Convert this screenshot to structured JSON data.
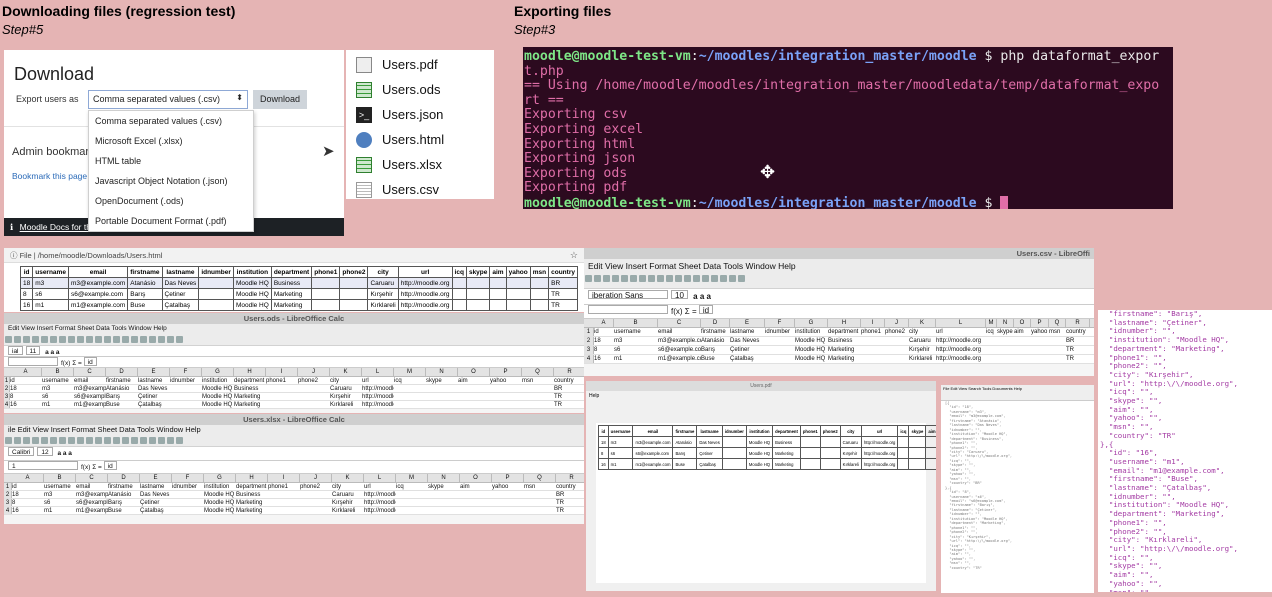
{
  "sections": {
    "download": {
      "title": "Downloading files (regression test)",
      "step": "Step#5"
    },
    "export": {
      "title": "Exporting files",
      "step": "Step#3"
    }
  },
  "moodle": {
    "title": "Download",
    "export_label": "Export users as",
    "select_value": "Comma separated values (.csv)",
    "download_button": "Download",
    "options": [
      "Comma separated values (.csv)",
      "Microsoft Excel (.xlsx)",
      "HTML table",
      "Javascript Object Notation (.json)",
      "OpenDocument (.ods)",
      "Portable Document Format (.pdf)"
    ],
    "admin_label": "Admin bookmarks",
    "bookmark_link": "Bookmark this page",
    "footer_link": "Moodle Docs for this page"
  },
  "files": [
    {
      "name": "Users.pdf",
      "icon": "pdf-file-icon",
      "color": "#666666"
    },
    {
      "name": "Users.ods",
      "icon": "spreadsheet-file-icon",
      "color": "#3a9c3a"
    },
    {
      "name": "Users.json",
      "icon": "terminal-file-icon",
      "color": "#222222"
    },
    {
      "name": "Users.html",
      "icon": "globe-file-icon",
      "color": "#4f7fbf"
    },
    {
      "name": "Users.xlsx",
      "icon": "spreadsheet-file-icon",
      "color": "#3a9c3a"
    },
    {
      "name": "Users.csv",
      "icon": "text-file-icon",
      "color": "#888888"
    }
  ],
  "terminal": {
    "prompt_user": "moodle@moodle-test-vm",
    "prompt_path": "~/moodles/integration_master/moodle",
    "command": "$ php dataformat_expor",
    "command_wrap": "t.php",
    "lines": [
      "== Using /home/moodle/moodles/integration_master/moodledata/temp/dataformat_expo",
      "rt ==",
      "Exporting csv",
      "Exporting excel",
      "Exporting html",
      "Exporting json",
      "Exporting ods",
      "Exporting pdf"
    ],
    "prompt_end": "$"
  },
  "browser": {
    "url": "File  |  /home/moodle/Downloads/Users.html"
  },
  "table": {
    "headers": [
      "id",
      "username",
      "email",
      "firstname",
      "lastname",
      "idnumber",
      "institution",
      "department",
      "phone1",
      "phone2",
      "city",
      "url",
      "icq",
      "skype",
      "aim",
      "yahoo",
      "msn",
      "country"
    ],
    "rows": [
      [
        "18",
        "m3",
        "m3@example.com",
        "Atanásio",
        "Das Neves",
        "",
        "Moodle HQ",
        "Business",
        "",
        "",
        "Caruaru",
        "http://moodle.org",
        "",
        "",
        "",
        "",
        "",
        "BR"
      ],
      [
        "8",
        "s6",
        "s6@example.com",
        "Barış",
        "Çetiner",
        "",
        "Moodle HQ",
        "Marketing",
        "",
        "",
        "Kırşehir",
        "http://moodle.org",
        "",
        "",
        "",
        "",
        "",
        "TR"
      ],
      [
        "16",
        "m1",
        "m1@example.com",
        "Buse",
        "Çatalbaş",
        "",
        "Moodle HQ",
        "Marketing",
        "",
        "",
        "Kırklareli",
        "http://moodle.org",
        "",
        "",
        "",
        "",
        "",
        "TR"
      ]
    ]
  },
  "ods": {
    "title": "Users.ods - LibreOffice Calc",
    "menu": "Edit  View  Insert  Format  Sheet  Data  Tools  Window  Help",
    "font": "ial",
    "size": "11",
    "cell": "id"
  },
  "xlsx": {
    "title": "Users.xlsx - LibreOffice Calc",
    "menu": "ile  Edit  View  Insert  Format  Sheet  Data  Tools  Window  Help",
    "font": "Calibri",
    "size": "12",
    "cell": "id",
    "name_box": "1"
  },
  "csv": {
    "title": "Users.csv - LibreOffi",
    "menu": "Edit  View  Insert  Format  Sheet  Data  Tools  Window  Help",
    "font": "iberation Sans",
    "size": "10",
    "cell": "id"
  },
  "pdf": {
    "title": "Users.pdf",
    "menu": "Help"
  },
  "json_small": {
    "menu": "File  Edit  View  Search  Tools  Documents  Help",
    "text": "[{\n  \"id\": \"18\",\n  \"username\": \"m3\",\n  \"email\": \"m3@example.com\",\n  \"firstname\": \"Atanásio\",\n  \"lastname\": \"Das Neves\",\n  \"idnumber\": \"\",\n  \"institution\": \"Moodle HQ\",\n  \"department\": \"Business\",\n  \"phone1\": \"\",\n  \"phone2\": \"\",\n  \"city\": \"Caruaru\",\n  \"url\": \"http:\\/\\/moodle.org\",\n  \"icq\": \"\",\n  \"skype\": \"\",\n  \"aim\": \"\",\n  \"yahoo\": \"\",\n  \"msn\": \"\",\n  \"country\": \"BR\"\n},{\n  \"id\": \"8\",\n  \"username\": \"s6\",\n  \"email\": \"s6@example.com\",\n  \"firstname\": \"Barış\",\n  \"lastname\": \"Çetiner\",\n  \"idnumber\": \"\",\n  \"institution\": \"Moodle HQ\",\n  \"department\": \"Marketing\",\n  \"phone1\": \"\",\n  \"phone2\": \"\",\n  \"city\": \"Kırşehir\",\n  \"url\": \"http:\\/\\/moodle.org\",\n  \"icq\": \"\",\n  \"skype\": \"\",\n  \"aim\": \"\",\n  \"yahoo\": \"\",\n  \"msn\": \"\",\n  \"country\": \"TR\""
  },
  "json_big": {
    "text": "  \"firstname\": \"Barış\",\n  \"lastname\": \"Çetiner\",\n  \"idnumber\": \"\",\n  \"institution\": \"Moodle HQ\",\n  \"department\": \"Marketing\",\n  \"phone1\": \"\",\n  \"phone2\": \"\",\n  \"city\": \"Kırşehir\",\n  \"url\": \"http:\\/\\/moodle.org\",\n  \"icq\": \"\",\n  \"skype\": \"\",\n  \"aim\": \"\",\n  \"yahoo\": \"\",\n  \"msn\": \"\",\n  \"country\": \"TR\"\n},{\n  \"id\": \"16\",\n  \"username\": \"m1\",\n  \"email\": \"m1@example.com\",\n  \"firstname\": \"Buse\",\n  \"lastname\": \"Çatalbaş\",\n  \"idnumber\": \"\",\n  \"institution\": \"Moodle HQ\",\n  \"department\": \"Marketing\",\n  \"phone1\": \"\",\n  \"phone2\": \"\",\n  \"city\": \"Kırklareli\",\n  \"url\": \"http:\\/\\/moodle.org\",\n  \"icq\": \"\",\n  \"skype\": \"\",\n  \"aim\": \"\",\n  \"yahoo\": \"\",\n  \"msn\": \"\",\n  \"country\": \"TR\"\n}]"
  },
  "colors": {
    "background": "#e5b4b4",
    "terminal_bg": "#2c0a1f",
    "terminal_text": "#e06ea8",
    "prompt_green": "#7ee787",
    "prompt_blue": "#7aa2f7"
  }
}
